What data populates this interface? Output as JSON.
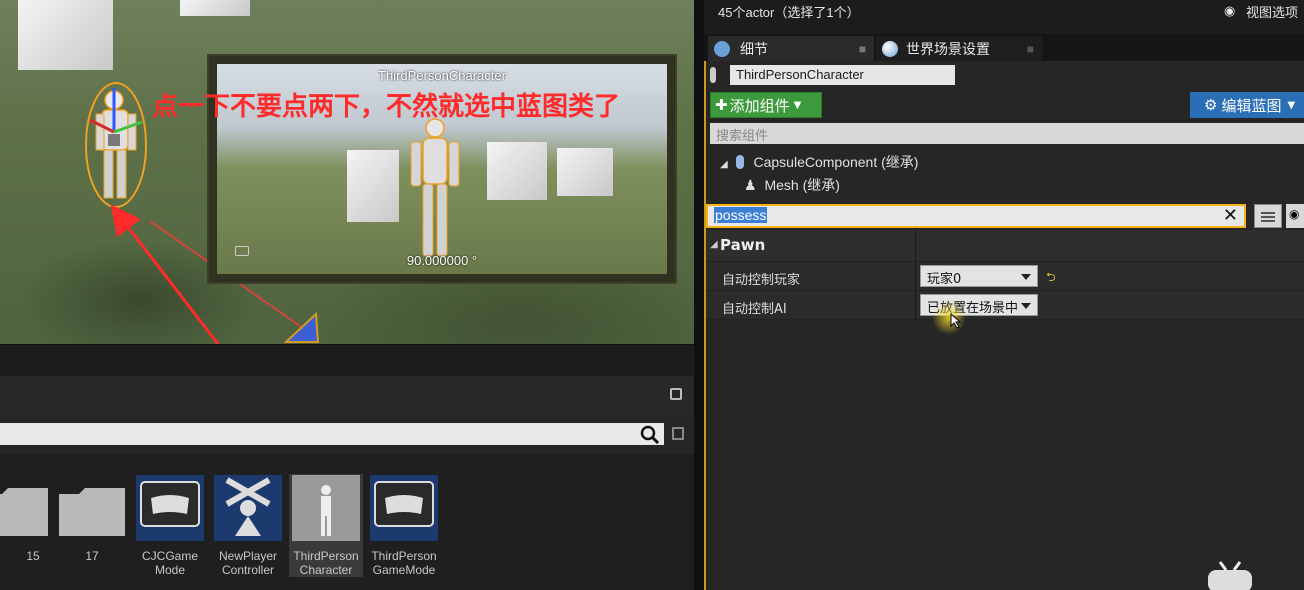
{
  "viewport": {
    "preview_title": "ThirdPersonCharacter",
    "preview_angle": "90.000000 °",
    "annotation": "点一下不要点两下，不然就选中蓝图类了"
  },
  "content_browser": {
    "search_value": "",
    "items": [
      {
        "label_line1": "15",
        "label_line2": "",
        "type": "folder"
      },
      {
        "label_line1": "17",
        "label_line2": "",
        "type": "folder"
      },
      {
        "label_line1": "CJCGame",
        "label_line2": "Mode",
        "type": "gamemode"
      },
      {
        "label_line1": "NewPlayer",
        "label_line2": "Controller",
        "type": "controller"
      },
      {
        "label_line1": "ThirdPerson",
        "label_line2": "Character",
        "type": "character"
      },
      {
        "label_line1": "ThirdPerson",
        "label_line2": "GameMode",
        "type": "gamemode"
      }
    ]
  },
  "outliner": {
    "status": "45个actor（选择了1个）",
    "view_options": "视图选项"
  },
  "tabs": [
    {
      "label": "细节",
      "icon": "magnifier-icon"
    },
    {
      "label": "世界场景设置",
      "icon": "globe-icon"
    }
  ],
  "details": {
    "actor_name": "ThirdPersonCharacter",
    "add_component_label": "添加组件",
    "edit_blueprint_label": "编辑蓝图",
    "component_search_placeholder": "搜索组件",
    "components": [
      {
        "label": "CapsuleComponent (继承)"
      },
      {
        "label": "Mesh (继承)"
      }
    ],
    "property_search_value": "possess",
    "category": "Pawn",
    "properties": [
      {
        "label": "自动控制玩家",
        "value": "玩家0"
      },
      {
        "label": "自动控制AI",
        "value": "已放置在场景中"
      }
    ]
  },
  "colors": {
    "annotation": "#ff2a2a",
    "focus_border": "#f3b414",
    "add_button": "#3c9a3c",
    "edit_button": "#2a6fb5"
  }
}
